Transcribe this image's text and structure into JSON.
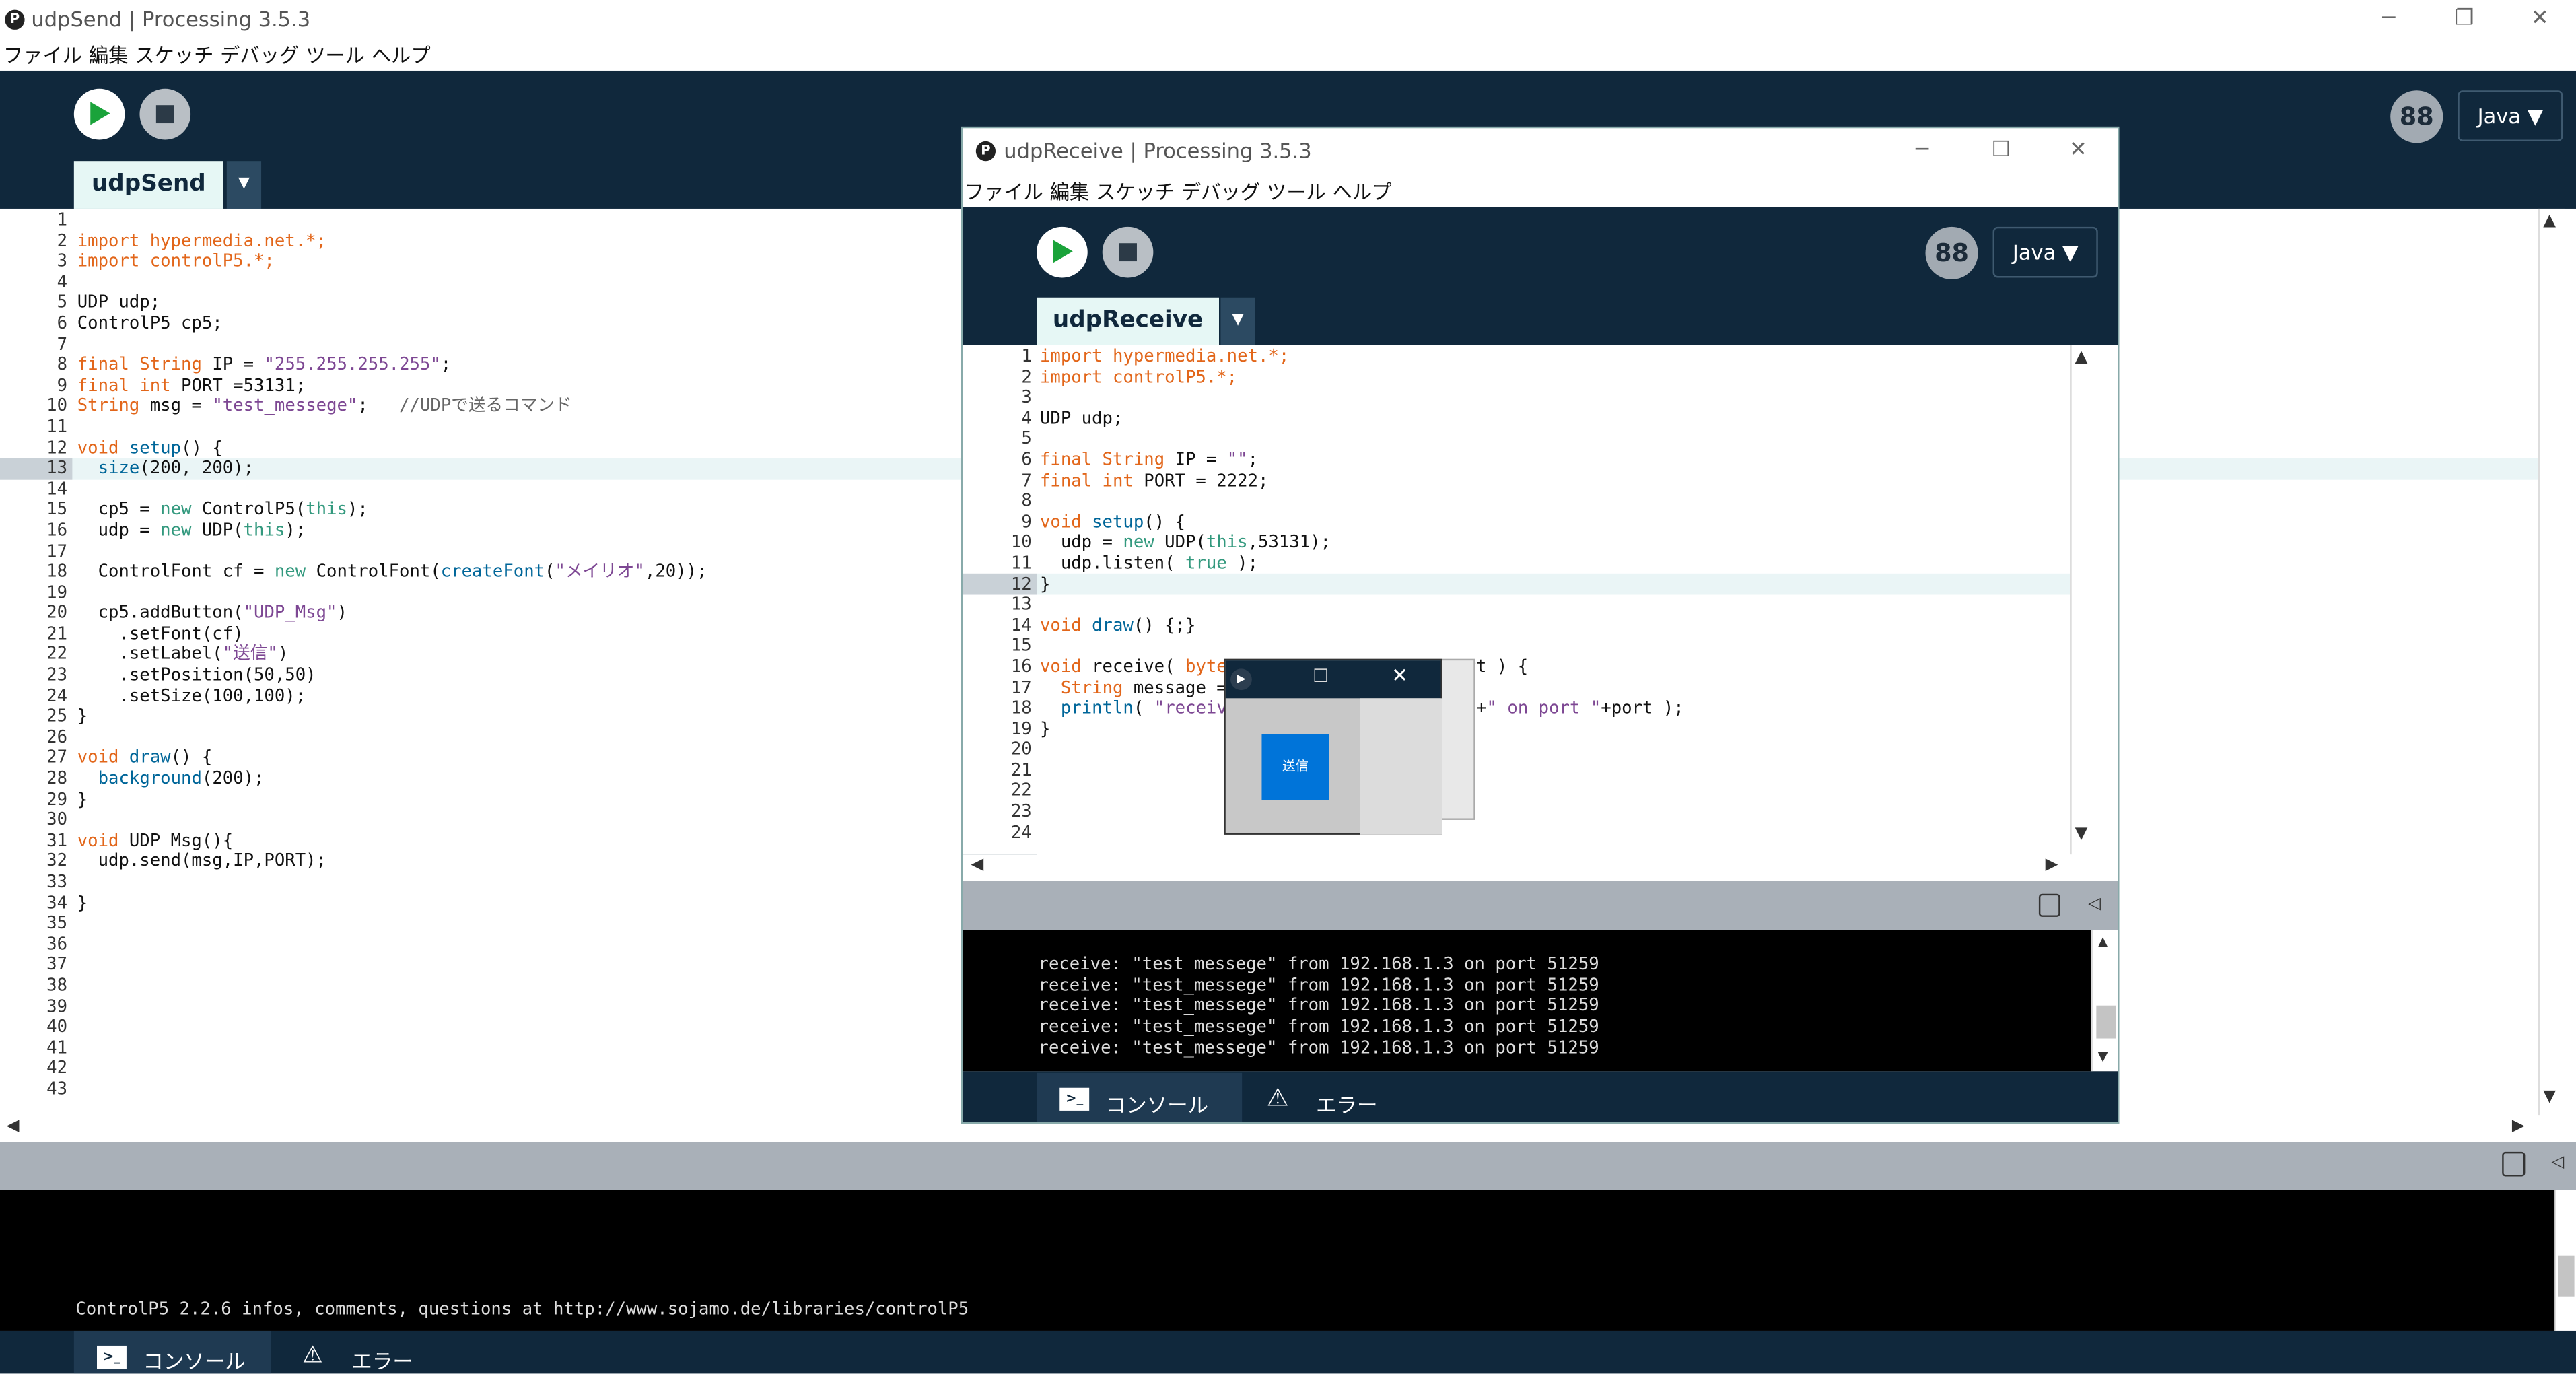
{
  "main_window": {
    "title": "udpSend | Processing 3.5.3",
    "app_icon": "P",
    "menu": [
      "ファイル",
      "編集",
      "スケッチ",
      "デバッグ",
      "ツール",
      "ヘルプ"
    ],
    "window_controls": {
      "minimize": "─",
      "restore": "❐",
      "close": "✕"
    },
    "mode_icon": "88",
    "mode": "Java ▼",
    "tab": "udpSend",
    "tab_menu": "▼",
    "highlight_line": 13,
    "line_numbers": [
      "1",
      "2",
      "3",
      "4",
      "5",
      "6",
      "7",
      "8",
      "9",
      "10",
      "11",
      "12",
      "13",
      "14",
      "15",
      "16",
      "17",
      "18",
      "19",
      "20",
      "21",
      "22",
      "23",
      "24",
      "25",
      "26",
      "27",
      "28",
      "29",
      "30",
      "31",
      "32",
      "33",
      "34",
      "35",
      "36",
      "37",
      "38",
      "39",
      "40",
      "41",
      "42",
      "43"
    ],
    "code_lines": [
      [],
      [
        {
          "t": "import hypermedia.net.*;",
          "c": "k"
        }
      ],
      [
        {
          "t": "import controlP5.*;",
          "c": "k"
        }
      ],
      [],
      [
        {
          "t": "UDP udp;",
          "c": ""
        }
      ],
      [
        {
          "t": "ControlP5 cp5;",
          "c": ""
        }
      ],
      [],
      [
        {
          "t": "final ",
          "c": "k"
        },
        {
          "t": "String",
          "c": "k"
        },
        {
          "t": " IP = ",
          "c": ""
        },
        {
          "t": "\"255.255.255.255\"",
          "c": "s"
        },
        {
          "t": ";",
          "c": ""
        }
      ],
      [
        {
          "t": "final ",
          "c": "k"
        },
        {
          "t": "int",
          "c": "k"
        },
        {
          "t": " PORT =53131;",
          "c": ""
        }
      ],
      [
        {
          "t": "String",
          "c": "k"
        },
        {
          "t": " msg = ",
          "c": ""
        },
        {
          "t": "\"test_messege\"",
          "c": "s"
        },
        {
          "t": ";   ",
          "c": ""
        },
        {
          "t": "//UDPで送るコマンド",
          "c": "c"
        }
      ],
      [],
      [
        {
          "t": "void ",
          "c": "k"
        },
        {
          "t": "setup",
          "c": "f"
        },
        {
          "t": "() {",
          "c": ""
        }
      ],
      [
        {
          "t": "  ",
          "c": ""
        },
        {
          "t": "size",
          "c": "f"
        },
        {
          "t": "(200, 200);",
          "c": ""
        }
      ],
      [],
      [
        {
          "t": "  cp5 = ",
          "c": ""
        },
        {
          "t": "new",
          "c": "t"
        },
        {
          "t": " ControlP5(",
          "c": ""
        },
        {
          "t": "this",
          "c": "t"
        },
        {
          "t": ");",
          "c": ""
        }
      ],
      [
        {
          "t": "  udp = ",
          "c": ""
        },
        {
          "t": "new",
          "c": "t"
        },
        {
          "t": " UDP(",
          "c": ""
        },
        {
          "t": "this",
          "c": "t"
        },
        {
          "t": ");",
          "c": ""
        }
      ],
      [],
      [
        {
          "t": "  ControlFont cf = ",
          "c": ""
        },
        {
          "t": "new",
          "c": "t"
        },
        {
          "t": " ControlFont(",
          "c": ""
        },
        {
          "t": "createFont",
          "c": "f"
        },
        {
          "t": "(",
          "c": ""
        },
        {
          "t": "\"メイリオ\"",
          "c": "s"
        },
        {
          "t": ",20));",
          "c": ""
        }
      ],
      [],
      [
        {
          "t": "  cp5.addButton(",
          "c": ""
        },
        {
          "t": "\"UDP_Msg\"",
          "c": "s"
        },
        {
          "t": ")",
          "c": ""
        }
      ],
      [
        {
          "t": "    .setFont(cf)",
          "c": ""
        }
      ],
      [
        {
          "t": "    .setLabel(",
          "c": ""
        },
        {
          "t": "\"送信\"",
          "c": "s"
        },
        {
          "t": ")",
          "c": ""
        }
      ],
      [
        {
          "t": "    .setPosition(50,50)",
          "c": ""
        }
      ],
      [
        {
          "t": "    .setSize(100,100);",
          "c": ""
        }
      ],
      [
        {
          "t": "}",
          "c": ""
        }
      ],
      [],
      [
        {
          "t": "void ",
          "c": "k"
        },
        {
          "t": "draw",
          "c": "f"
        },
        {
          "t": "() {",
          "c": ""
        }
      ],
      [
        {
          "t": "  ",
          "c": ""
        },
        {
          "t": "background",
          "c": "f"
        },
        {
          "t": "(200);",
          "c": ""
        }
      ],
      [
        {
          "t": "}",
          "c": ""
        }
      ],
      [],
      [
        {
          "t": "void ",
          "c": "k"
        },
        {
          "t": "UDP_Msg(){",
          "c": ""
        }
      ],
      [
        {
          "t": "  udp.send(msg,IP,PORT);",
          "c": ""
        }
      ],
      [],
      [
        {
          "t": "}",
          "c": ""
        }
      ]
    ],
    "console_lines": [
      "ControlP5 2.2.6 infos, comments, questions at http://www.sojamo.de/libraries/controlP5"
    ],
    "console_tab": "コンソール",
    "error_tab": "エラー"
  },
  "receive_window": {
    "title": "udpReceive | Processing 3.5.3",
    "app_icon": "P",
    "menu": [
      "ファイル",
      "編集",
      "スケッチ",
      "デバッグ",
      "ツール",
      "ヘルプ"
    ],
    "window_controls": {
      "minimize": "─",
      "maximize": "☐",
      "close": "✕"
    },
    "mode_icon": "88",
    "mode": "Java ▼",
    "tab": "udpReceive",
    "tab_menu": "▼",
    "highlight_line": 12,
    "line_numbers": [
      "1",
      "2",
      "3",
      "4",
      "5",
      "6",
      "7",
      "8",
      "9",
      "10",
      "11",
      "12",
      "13",
      "14",
      "15",
      "16",
      "17",
      "18",
      "19",
      "20",
      "21",
      "22",
      "23",
      "24"
    ],
    "code_lines": [
      [
        {
          "t": "import hypermedia.net.*;",
          "c": "k"
        }
      ],
      [
        {
          "t": "import controlP5.*;",
          "c": "k"
        }
      ],
      [],
      [
        {
          "t": "UDP udp;",
          "c": ""
        }
      ],
      [],
      [
        {
          "t": "final ",
          "c": "k"
        },
        {
          "t": "String",
          "c": "k"
        },
        {
          "t": " IP = ",
          "c": ""
        },
        {
          "t": "\"\"",
          "c": "s"
        },
        {
          "t": ";",
          "c": ""
        }
      ],
      [
        {
          "t": "final ",
          "c": "k"
        },
        {
          "t": "int",
          "c": "k"
        },
        {
          "t": " PORT = 2222;",
          "c": ""
        }
      ],
      [],
      [
        {
          "t": "void ",
          "c": "k"
        },
        {
          "t": "setup",
          "c": "f"
        },
        {
          "t": "() {",
          "c": ""
        }
      ],
      [
        {
          "t": "  udp = ",
          "c": ""
        },
        {
          "t": "new",
          "c": "t"
        },
        {
          "t": " UDP(",
          "c": ""
        },
        {
          "t": "this",
          "c": "t"
        },
        {
          "t": ",53131);",
          "c": ""
        }
      ],
      [
        {
          "t": "  udp.listen( ",
          "c": ""
        },
        {
          "t": "true",
          "c": "t"
        },
        {
          "t": " );",
          "c": ""
        }
      ],
      [
        {
          "t": "}",
          "c": ""
        }
      ],
      [],
      [
        {
          "t": "void ",
          "c": "k"
        },
        {
          "t": "draw",
          "c": "f"
        },
        {
          "t": "() {;}",
          "c": ""
        }
      ],
      [],
      [
        {
          "t": "void ",
          "c": "k"
        },
        {
          "t": "receive( ",
          "c": ""
        },
        {
          "t": "byte",
          "c": "k"
        },
        {
          "t": "                   ",
          "c": ""
        },
        {
          "t": "t",
          "c": "k"
        },
        {
          "t": " port ) {",
          "c": ""
        }
      ],
      [
        {
          "t": "  ",
          "c": ""
        },
        {
          "t": "String",
          "c": "k"
        },
        {
          "t": " message = ",
          "c": ""
        }
      ],
      [
        {
          "t": "  ",
          "c": ""
        },
        {
          "t": "println",
          "c": "f"
        },
        {
          "t": "( ",
          "c": ""
        },
        {
          "t": "\"receive",
          "c": "s"
        },
        {
          "t": "                    +ip+",
          "c": ""
        },
        {
          "t": "\" on port \"",
          "c": "s"
        },
        {
          "t": "+port );",
          "c": ""
        }
      ],
      [
        {
          "t": "}",
          "c": ""
        }
      ]
    ],
    "console_lines": [
      "receive: \"test_messege\" from 192.168.1.3 on port 51259",
      "receive: \"test_messege\" from 192.168.1.3 on port 51259",
      "receive: \"test_messege\" from 192.168.1.3 on port 51259",
      "receive: \"test_messege\" from 192.168.1.3 on port 51259",
      "receive: \"test_messege\" from 192.168.1.3 on port 51259"
    ],
    "console_tab": "コンソール",
    "error_tab": "エラー"
  },
  "sketch_window": {
    "button_label": "送信",
    "controls": {
      "maximize": "☐",
      "close": "✕"
    }
  }
}
